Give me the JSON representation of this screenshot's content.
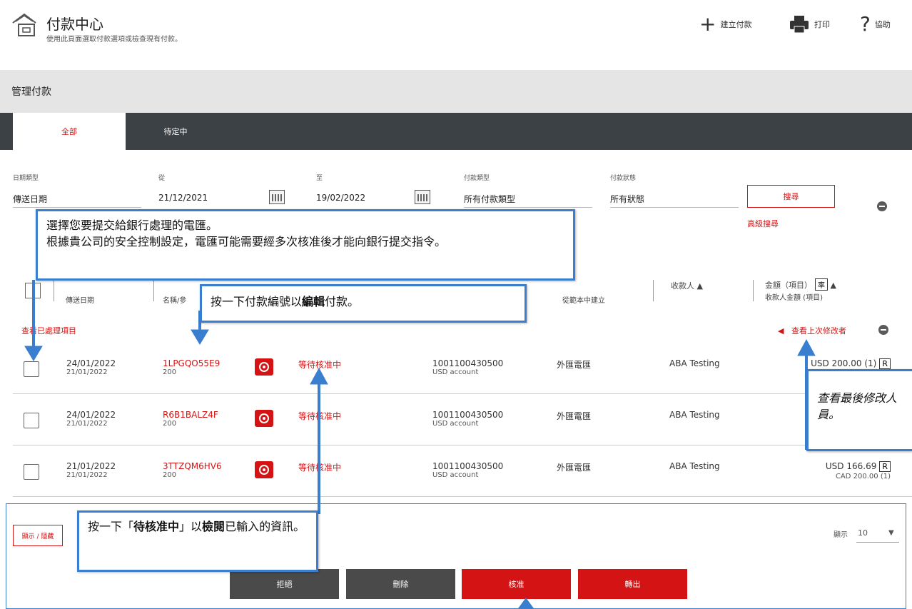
{
  "header": {
    "title": "付款中心",
    "subtitle": "使用此頁面選取付款選項或檢查現有付款。",
    "create_label": "建立付款",
    "print_label": "打印",
    "help_label": "協助"
  },
  "manage": {
    "title": "管理付款"
  },
  "tabs": [
    {
      "label": "全部",
      "active": true
    },
    {
      "label": "待定中",
      "active": false
    }
  ],
  "filters": {
    "date_type_label": "日期類型",
    "date_type_value": "傳送日期",
    "from_label": "從",
    "from_value": "21/12/2021",
    "to_label": "至",
    "to_value": "19/02/2022",
    "payment_type_label": "付款類型",
    "payment_type_value": "所有付款類型",
    "payment_status_label": "付款狀態",
    "payment_status_value": "所有狀態",
    "search_label": "搜尋",
    "advanced_label": "高級搜尋"
  },
  "table": {
    "headers": {
      "date_sub": "傳送日期",
      "ref_sub": "名稱/參",
      "account_sub": "從範本中建立",
      "payee": "收款人",
      "amount": "金額（項目）",
      "rate": "率",
      "amount_sub": "收款人金額 (項目)"
    },
    "view_processed": "查看已處理項目",
    "view_last_modifier": "查看上次修改者",
    "rows": [
      {
        "date1": "24/01/2022",
        "date2": "21/01/2022",
        "ref": "1LPGQO55E9",
        "ref_sub": "200",
        "status": "等待核准中",
        "account": "1001100430500",
        "account_sub": "USD account",
        "ptype": "外匯電匯",
        "payee": "ABA Testing",
        "amount": "USD 200.00 (1)",
        "amount_sub": "",
        "badge": "R"
      },
      {
        "date1": "24/01/2022",
        "date2": "21/01/2022",
        "ref": "R6B1BALZ4F",
        "ref_sub": "200",
        "status": "等待核准中",
        "account": "1001100430500",
        "account_sub": "USD account",
        "ptype": "外匯電匯",
        "payee": "ABA Testing",
        "amount": "",
        "amount_sub": "",
        "badge": ""
      },
      {
        "date1": "21/01/2022",
        "date2": "21/01/2022",
        "ref": "3TTZQM6HV6",
        "ref_sub": "200",
        "status": "等待核准中",
        "account": "1001100430500",
        "account_sub": "USD account",
        "ptype": "外匯電匯",
        "payee": "ABA Testing",
        "amount": "USD 166.69",
        "amount_sub": "CAD 200.00 (1)",
        "badge": "R"
      }
    ]
  },
  "bottom": {
    "show_hide": "顯示 / 隱藏",
    "show_label": "顯示",
    "show_value": "10",
    "actions": [
      {
        "label": "拒絕",
        "color": "#4a4a4a"
      },
      {
        "label": "刪除",
        "color": "#4a4a4a"
      },
      {
        "label": "核准",
        "color": "#d41414"
      },
      {
        "label": "轉出",
        "color": "#d41414"
      }
    ]
  },
  "callouts": {
    "select_line1": "選擇您要提交給銀行處理的電匯。",
    "select_line2": "根據貴公司的安全控制設定，電匯可能需要經多次核准後才能向銀行提交指令。",
    "edit_pre": "按一下付款編號以",
    "edit_bold": "編輯",
    "edit_post": "付款。",
    "review_pre": "按一下「",
    "review_bold1": "待核准中",
    "review_mid": "」以",
    "review_bold2": "檢閱",
    "review_post": "已輸入的資訊。",
    "modifier": "查看最後修改人員。"
  },
  "colors": {
    "brand_red": "#d41414",
    "tab_dark": "#3c4145",
    "callout_blue": "#3a7ed0"
  }
}
